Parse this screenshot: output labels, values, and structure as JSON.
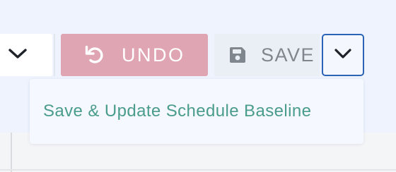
{
  "toolbar": {
    "undo_label": "UNDO",
    "save_label": "SAVE"
  },
  "dropdown_menu": {
    "items": [
      {
        "label": "Save & Update Schedule Baseline"
      }
    ]
  },
  "icons": {
    "left_dropdown": "chevron-down-icon",
    "undo": "undo-icon",
    "save": "floppy-disk-icon",
    "save_toggle": "chevron-down-icon"
  },
  "colors": {
    "undo_button": "#e0a5b2",
    "focus_ring": "#2b64b7",
    "menu_text": "#4a9c8d",
    "save_text": "#80868e"
  }
}
